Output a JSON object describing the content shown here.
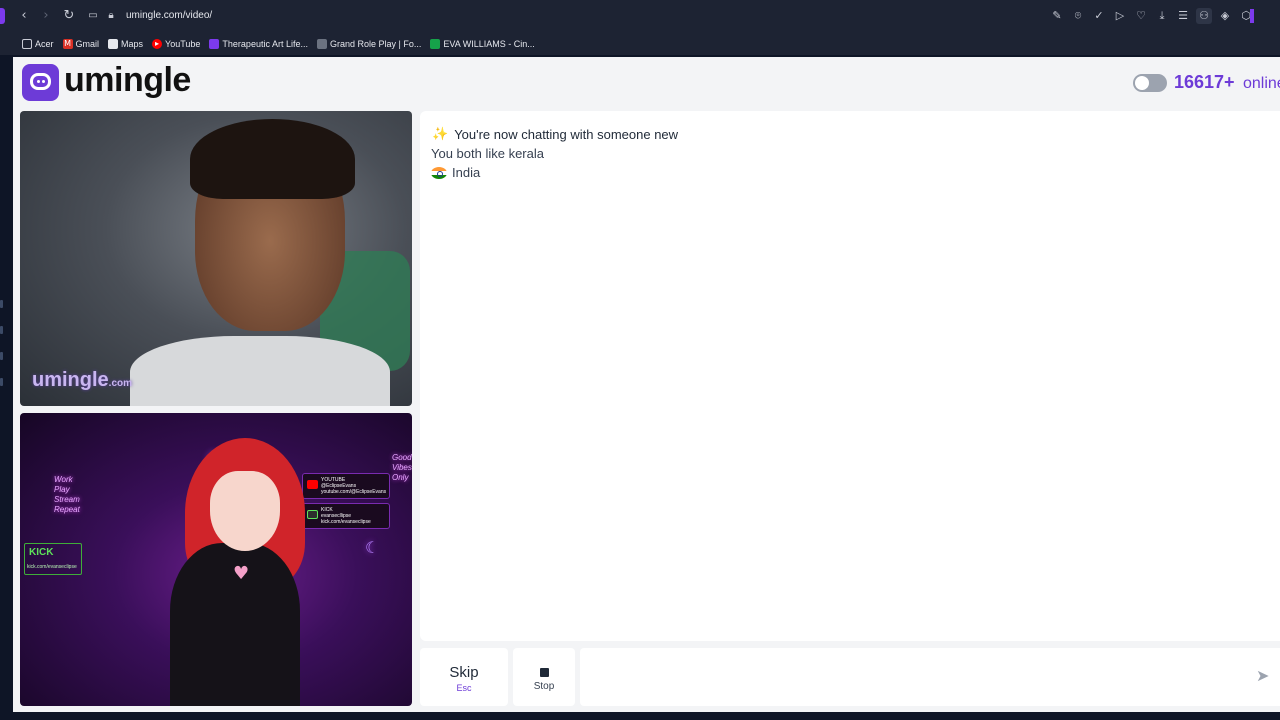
{
  "browser": {
    "url": "umingle.com/video/",
    "nav_icons": [
      "back-icon",
      "forward-icon",
      "reload-icon",
      "page-icon",
      "lock-icon"
    ],
    "toolbar_icons": [
      "edit-icon",
      "camera-icon",
      "shield-check-icon",
      "play-icon",
      "heart-icon",
      "download-icon",
      "menu-icon",
      "profile-icon",
      "extension-icon",
      "cube-icon"
    ],
    "accent_color": "#7c3aed"
  },
  "bookmarks": [
    {
      "label": "Acer",
      "icon": "folder-icon",
      "color": "#3a4152"
    },
    {
      "label": "Gmail",
      "icon": "gmail-icon",
      "color": "#d93025"
    },
    {
      "label": "Maps",
      "icon": "file-icon",
      "color": "#3a4152"
    },
    {
      "label": "YouTube",
      "icon": "youtube-icon",
      "color": "#ff0000"
    },
    {
      "label": "Therapeutic Art Life...",
      "icon": "therapeutic-art-icon",
      "color": "#7c3aed"
    },
    {
      "label": "Grand Role Play | Fo...",
      "icon": "grand-roleplay-icon",
      "color": "#6b7280"
    },
    {
      "label": "EVA WILLIAMS - Cin...",
      "icon": "eva-williams-icon",
      "color": "#16a34a"
    }
  ],
  "header": {
    "logo_text": "umingle",
    "online_count": "16617+",
    "online_label": "online",
    "brand_color": "#6d3bd7"
  },
  "videos": {
    "stranger_watermark": "umingle",
    "stranger_watermark_suffix": ".com",
    "self_overlay": {
      "neon_left": "Work\nPlay\nStream\nRepeat",
      "neon_right": "Good\nVibes\nOnly",
      "youtube_card": "YOUTUBE\n@EclipseEvans\nyoutube.com/@EclipseEvans",
      "kick_card": "KICK\nevansecllipse\nkick.com/evanseclipse",
      "kick_sign_title": "KICK",
      "kick_sign_url": "kick.com/evanseclipse"
    }
  },
  "chat": {
    "connected_message": "You're now chatting with someone new",
    "shared_interest": "You both like kerala",
    "country": "India"
  },
  "controls": {
    "skip_label": "Skip",
    "skip_key": "Esc",
    "stop_label": "Stop",
    "message_placeholder": ""
  }
}
